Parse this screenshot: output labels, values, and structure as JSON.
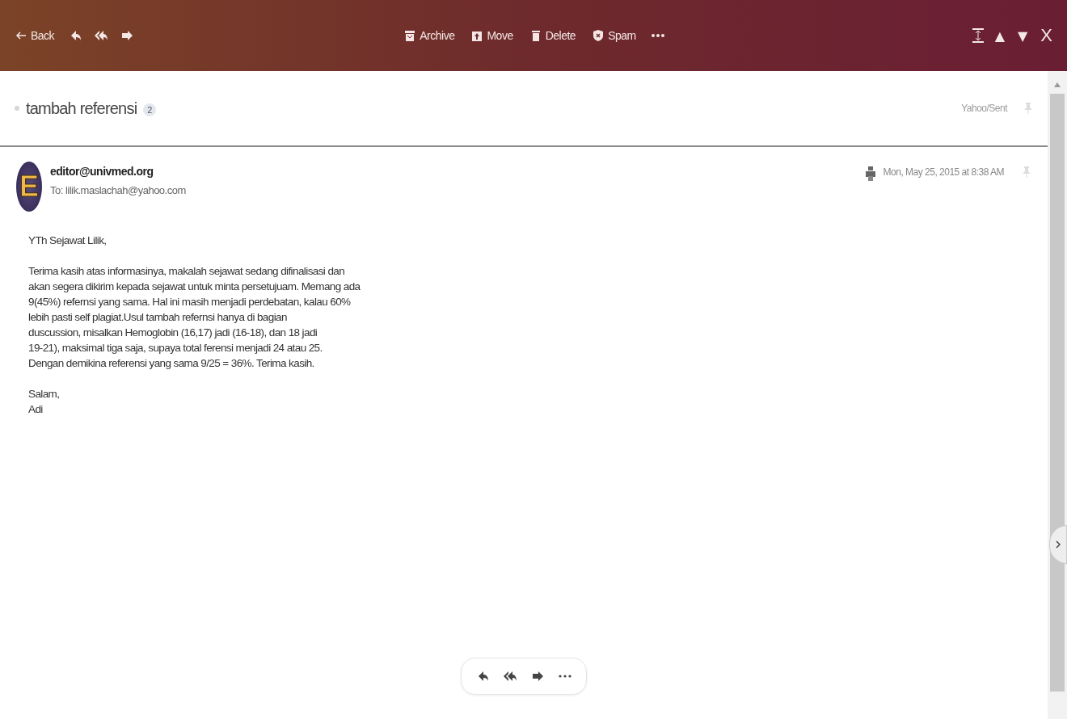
{
  "toolbar": {
    "back": "Back",
    "actions": [
      {
        "kind": "archive",
        "label": "Archive"
      },
      {
        "kind": "move",
        "label": "Move"
      },
      {
        "kind": "delete",
        "label": "Delete"
      },
      {
        "kind": "spam",
        "label": "Spam"
      }
    ],
    "nav": [
      "▲",
      "▼"
    ],
    "close": "X"
  },
  "conversation": {
    "subject": "tambah referensi",
    "count": "2",
    "folder": "Yahoo/Sent"
  },
  "message": {
    "avatar_letter": "E",
    "from": "editor@univmed.org",
    "to": "To: lilik.maslachah@yahoo.com",
    "date": "Mon, May 25, 2015 at 8:38 AM",
    "greeting": "YTh Sejawat Lilik,",
    "body_lines": [
      "Terima kasih atas informasinya, makalah sejawat sedang difinalisasi dan",
      "akan segera dikirim kepada sejawat untuk minta persetujuam. Memang ada",
      "9(45%) refernsi yang sama. Hal ini masih menjadi perdebatan, kalau 60%",
      "lebih pasti self plagiat.Usul tambah refernsi hanya di bagian",
      "duscussion, misalkan Hemoglobin  (16,17) jadi (16-18), dan 18 jadi",
      "19-21), maksimal tiga saja, supaya total ferensi menjadi 24 atau 25.",
      "Dengan demikina referensi yang sama 9/25 = 36%. Terima kasih."
    ],
    "closing": "Salam,",
    "signature": "Adi"
  }
}
